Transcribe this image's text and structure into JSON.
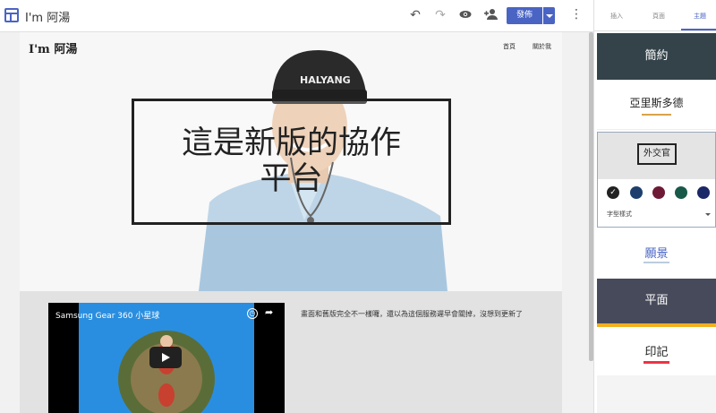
{
  "toolbar": {
    "site_title": "I'm 阿湯",
    "publish_label": "發佈",
    "icons": [
      "undo-icon",
      "redo-icon",
      "preview-icon",
      "add-person-icon",
      "more-vert-icon"
    ]
  },
  "site": {
    "logo": "I'm 阿湯",
    "nav": [
      "首頁",
      "關於我"
    ],
    "hero_title_line1": "這是新版的協作",
    "hero_title_line2": "平台",
    "video_title": "Samsung Gear 360 小星球",
    "description": "畫面和舊版完全不一樣囉，還以為這個服務遲早會關掉，沒想到更新了"
  },
  "panel": {
    "tabs": [
      "插入",
      "頁面",
      "主題"
    ],
    "active_tab": "主題",
    "themes": {
      "simple": "簡約",
      "aristotle": "亞里斯多德",
      "diplomat": "外交官",
      "vision": "願景",
      "flat": "平面",
      "stamp": "印記"
    },
    "font_style_label": "字型樣式",
    "swatches": [
      "#222222",
      "#1e3f6e",
      "#6e1a36",
      "#19594a",
      "#1a2868"
    ]
  }
}
